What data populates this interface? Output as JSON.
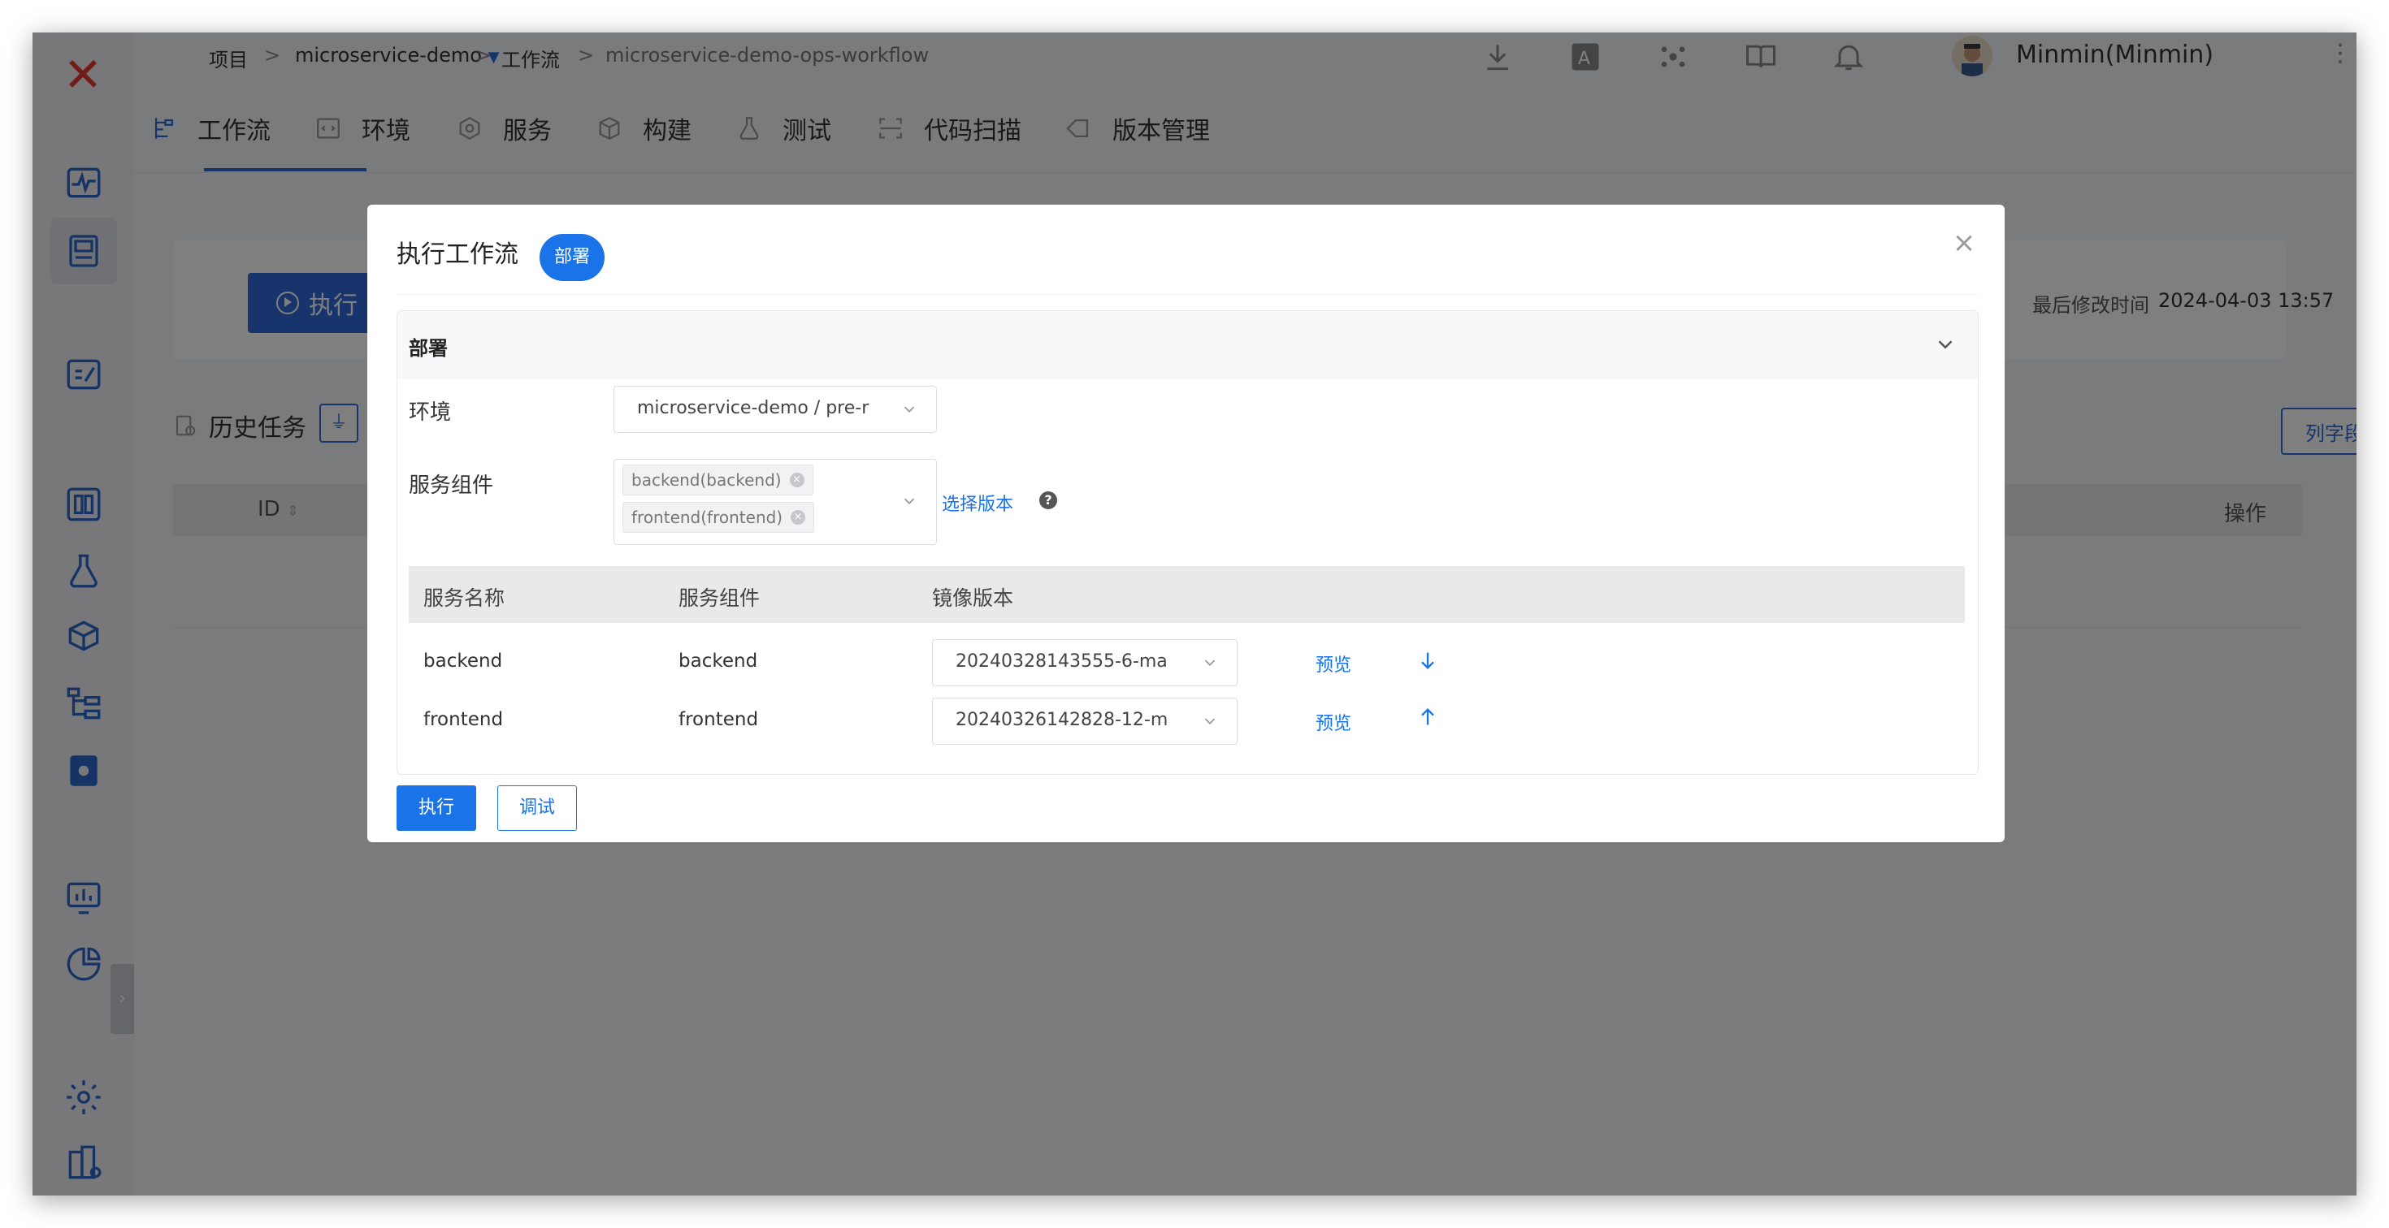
{
  "breadcrumb": {
    "project": "项目",
    "project_name": "microservice-demo",
    "workflow": "工作流",
    "workflow_name": "microservice-demo-ops-workflow",
    "separator": ">"
  },
  "user": {
    "name": "Minmin(Minmin)"
  },
  "tabs": [
    {
      "label": "工作流",
      "icon": "workflow-icon",
      "active": true
    },
    {
      "label": "环境",
      "icon": "code-window-icon"
    },
    {
      "label": "服务",
      "icon": "hexagon-gear-icon"
    },
    {
      "label": "构建",
      "icon": "cube-icon"
    },
    {
      "label": "测试",
      "icon": "flask-icon"
    },
    {
      "label": "代码扫描",
      "icon": "scan-icon"
    },
    {
      "label": "版本管理",
      "icon": "tag-icon"
    }
  ],
  "page": {
    "run_button": "执行",
    "modified_label": "最后修改时间",
    "modified_value": "2024-04-03 13:57",
    "history_title": "历史任务",
    "columns_button": "列字段",
    "table_head": {
      "id": "ID",
      "operation": "操作"
    }
  },
  "modal": {
    "title": "执行工作流",
    "badge": "部署",
    "close": "×",
    "section_title": "部署",
    "env_label": "环境",
    "env_value": "microservice-demo / pre-r",
    "components_label": "服务组件",
    "components": [
      "backend(backend)",
      "frontend(frontend)"
    ],
    "select_version_link": "选择版本",
    "help": "?",
    "table": {
      "headers": [
        "服务名称",
        "服务组件",
        "镜像版本"
      ],
      "rows": [
        {
          "service": "backend",
          "component": "backend",
          "image": "20240328143555-6-ma",
          "preview": "预览",
          "arrow": "down"
        },
        {
          "service": "frontend",
          "component": "frontend",
          "image": "20240326142828-12-m",
          "preview": "预览",
          "arrow": "up"
        }
      ]
    },
    "run_button": "执行",
    "debug_button": "调试"
  },
  "colors": {
    "accent": "#1a73e8",
    "brand_logo": "#e23a2e",
    "overlay": "rgba(0,0,0,0.5)"
  }
}
